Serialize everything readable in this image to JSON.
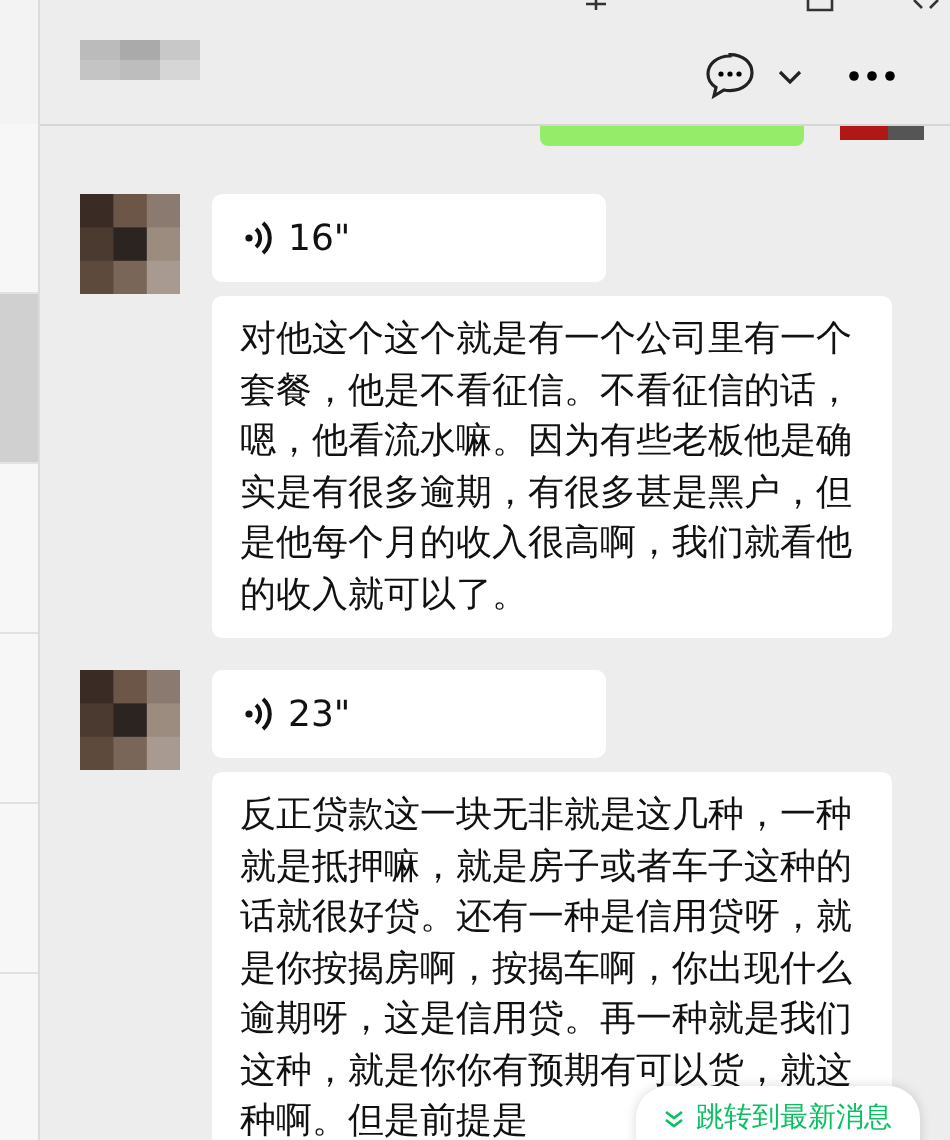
{
  "sidebar": {
    "items": [
      {
        "selected": false
      },
      {
        "selected": true
      },
      {
        "selected": false
      },
      {
        "selected": false
      },
      {
        "selected": false
      },
      {
        "selected": false
      }
    ]
  },
  "messages": [
    {
      "kind": "own_cut"
    },
    {
      "kind": "voice",
      "duration": "16\"",
      "transcript": "对他这个这个就是有一个公司里有一个套餐，他是不看征信。不看征信的话，嗯，他看流水嘛。因为有些老板他是确实是有很多逾期，有很多甚是黑户，但是他每个月的收入很高啊，我们就看他的收入就可以了。"
    },
    {
      "kind": "voice",
      "duration": "23\"",
      "transcript": "反正贷款这一块无非就是这几种，一种就是抵押嘛，就是房子或者车子这种的话就很好贷。还有一种是信用贷呀，就是你按揭房啊，按揭车啊，你出现什么逾期呀，这是信用贷。再一种就是我们这种，就是你你有预期有可以货，就这种啊。但是前提是"
    }
  ],
  "jump_to_latest": "跳转到最新消息"
}
